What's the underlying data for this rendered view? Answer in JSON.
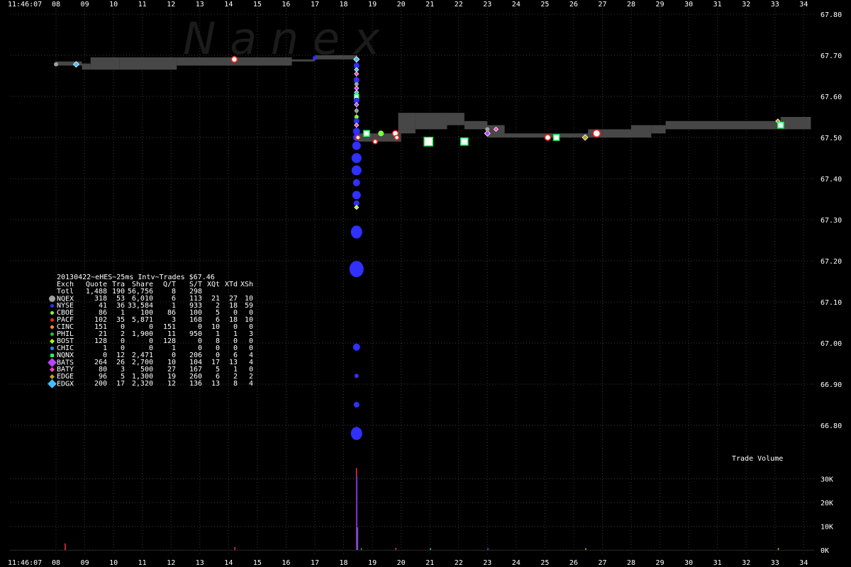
{
  "chart_data": {
    "type": "scatter",
    "watermark": "N a n e x",
    "title": "20130422~eHES~25ms Intv~Trades $67.46",
    "time_start_label": "11:46:07",
    "x_ticks": [
      "08",
      "09",
      "10",
      "11",
      "12",
      "13",
      "14",
      "15",
      "16",
      "17",
      "18",
      "19",
      "20",
      "21",
      "22",
      "23",
      "24",
      "25",
      "26",
      "27",
      "28",
      "29",
      "30",
      "31",
      "32",
      "33",
      "34"
    ],
    "price_ticks": [
      "67.80",
      "67.70",
      "67.60",
      "67.50",
      "67.40",
      "67.30",
      "67.20",
      "67.10",
      "67.00",
      "66.90",
      "66.80"
    ],
    "price_range": [
      66.75,
      67.8
    ],
    "volume_label": "Trade Volume",
    "volume_ticks": [
      "30K",
      "20K",
      "10K",
      "0K"
    ],
    "volume_range": [
      0,
      36000
    ],
    "grid": true,
    "legend_position": "left",
    "table": {
      "headers": [
        "Exch",
        "Quote",
        "Tra",
        "Share",
        "Q/T",
        "S/T",
        "XQt",
        "XTd",
        "XSh"
      ],
      "rows": [
        {
          "cells": [
            "Totl",
            "1,488",
            "190",
            "56,756",
            "8",
            "298",
            "",
            "",
            ""
          ],
          "marker": "",
          "color": ""
        },
        {
          "cells": [
            "NQEX",
            "318",
            "53",
            "6,010",
            "6",
            "113",
            "21",
            "27",
            "10"
          ],
          "marker": "circle-large",
          "color": "#a0a0a0"
        },
        {
          "cells": [
            "NYSE",
            "41",
            "36",
            "33,584",
            "1",
            "933",
            "2",
            "18",
            "59"
          ],
          "marker": "circle",
          "color": "#3030ff"
        },
        {
          "cells": [
            "CBOE",
            "86",
            "1",
            "100",
            "86",
            "100",
            "5",
            "0",
            "0"
          ],
          "marker": "circle",
          "color": "#80ff40"
        },
        {
          "cells": [
            "PACF",
            "102",
            "35",
            "5,871",
            "3",
            "168",
            "6",
            "18",
            "10"
          ],
          "marker": "circle",
          "color": "#ff2020"
        },
        {
          "cells": [
            "CINC",
            "151",
            "0",
            "0",
            "151",
            "0",
            "10",
            "0",
            "0"
          ],
          "marker": "circle",
          "color": "#ff9020"
        },
        {
          "cells": [
            "PHIL",
            "21",
            "2",
            "1,900",
            "11",
            "950",
            "1",
            "1",
            "3"
          ],
          "marker": "circle",
          "color": "#20c020"
        },
        {
          "cells": [
            "BOST",
            "128",
            "0",
            "0",
            "128",
            "0",
            "8",
            "0",
            "0"
          ],
          "marker": "diamond",
          "color": "#a0ff20"
        },
        {
          "cells": [
            "CHIC",
            "1",
            "0",
            "0",
            "1",
            "0",
            "0",
            "0",
            "0"
          ],
          "marker": "circle",
          "color": "#2090ff"
        },
        {
          "cells": [
            "NQNX",
            "0",
            "12",
            "2,471",
            "0",
            "206",
            "0",
            "6",
            "4"
          ],
          "marker": "square",
          "color": "#20ff60"
        },
        {
          "cells": [
            "BATS",
            "264",
            "26",
            "2,700",
            "10",
            "104",
            "17",
            "13",
            "4"
          ],
          "marker": "diamond-large",
          "color": "#c040ff"
        },
        {
          "cells": [
            "BATY",
            "80",
            "3",
            "500",
            "27",
            "167",
            "5",
            "1",
            "0"
          ],
          "marker": "diamond",
          "color": "#ff40c0"
        },
        {
          "cells": [
            "EDGE",
            "96",
            "5",
            "1,300",
            "19",
            "260",
            "6",
            "2",
            "2"
          ],
          "marker": "diamond",
          "color": "#c0a020"
        },
        {
          "cells": [
            "EDGX",
            "200",
            "17",
            "2,320",
            "12",
            "136",
            "13",
            "8",
            "4"
          ],
          "marker": "diamond-large",
          "color": "#40c0ff"
        }
      ]
    },
    "nbbo_band": [
      {
        "x": [
          7.98,
          8.9
        ],
        "low": 67.675,
        "high": 67.685
      },
      {
        "x": [
          8.9,
          9.2
        ],
        "low": 67.665,
        "high": 67.68
      },
      {
        "x": [
          9.2,
          10.2
        ],
        "low": 67.665,
        "high": 67.695
      },
      {
        "x": [
          10.2,
          12.2
        ],
        "low": 67.665,
        "high": 67.695
      },
      {
        "x": [
          12.2,
          16.2
        ],
        "low": 67.675,
        "high": 67.695
      },
      {
        "x": [
          16.2,
          17.0
        ],
        "low": 67.685,
        "high": 67.69
      },
      {
        "x": [
          17.0,
          18.45
        ],
        "low": 67.69,
        "high": 67.7
      },
      {
        "x": [
          18.5,
          19.0
        ],
        "low": 67.49,
        "high": 67.51
      },
      {
        "x": [
          19.0,
          20.0
        ],
        "low": 67.49,
        "high": 67.51
      },
      {
        "x": [
          19.9,
          20.5
        ],
        "low": 67.51,
        "high": 67.56
      },
      {
        "x": [
          20.5,
          21.6
        ],
        "low": 67.52,
        "high": 67.56
      },
      {
        "x": [
          21.6,
          22.2
        ],
        "low": 67.53,
        "high": 67.56
      },
      {
        "x": [
          22.2,
          23.0
        ],
        "low": 67.52,
        "high": 67.54
      },
      {
        "x": [
          23.0,
          23.6
        ],
        "low": 67.5,
        "high": 67.53
      },
      {
        "x": [
          23.6,
          24.4
        ],
        "low": 67.5,
        "high": 67.51
      },
      {
        "x": [
          24.4,
          26.5
        ],
        "low": 67.5,
        "high": 67.51
      },
      {
        "x": [
          26.5,
          27.0
        ],
        "low": 67.5,
        "high": 67.52
      },
      {
        "x": [
          27.0,
          28.0
        ],
        "low": 67.5,
        "high": 67.52
      },
      {
        "x": [
          28.0,
          28.7
        ],
        "low": 67.5,
        "high": 67.53
      },
      {
        "x": [
          28.7,
          29.2
        ],
        "low": 67.51,
        "high": 67.53
      },
      {
        "x": [
          29.2,
          33.2
        ],
        "low": 67.52,
        "high": 67.54
      },
      {
        "x": [
          33.2,
          34.25
        ],
        "low": 67.52,
        "high": 67.55
      }
    ],
    "trades": [
      {
        "x": 8.0,
        "y": 67.678,
        "exch": "NQEX",
        "r": 3
      },
      {
        "x": 8.7,
        "y": 67.678,
        "exch": "EDGX",
        "r": 4
      },
      {
        "x": 14.2,
        "y": 67.69,
        "exch": "PACF",
        "r": 4
      },
      {
        "x": 17.0,
        "y": 67.693,
        "exch": "NYSE",
        "r": 3
      },
      {
        "x": 18.45,
        "y": 67.69,
        "exch": "EDGX",
        "r": 4
      },
      {
        "x": 18.45,
        "y": 67.675,
        "exch": "NYSE",
        "r": 4
      },
      {
        "x": 18.45,
        "y": 67.665,
        "exch": "EDGX",
        "r": 3
      },
      {
        "x": 18.45,
        "y": 67.655,
        "exch": "BATY",
        "r": 3
      },
      {
        "x": 18.45,
        "y": 67.64,
        "exch": "NYSE",
        "r": 4
      },
      {
        "x": 18.45,
        "y": 67.63,
        "exch": "NQEX",
        "r": 3
      },
      {
        "x": 18.45,
        "y": 67.62,
        "exch": "BATS",
        "r": 3
      },
      {
        "x": 18.45,
        "y": 67.61,
        "exch": "EDGX",
        "r": 3
      },
      {
        "x": 18.45,
        "y": 67.6,
        "exch": "NQNX",
        "r": 3
      },
      {
        "x": 18.45,
        "y": 67.59,
        "exch": "NYSE",
        "r": 4
      },
      {
        "x": 18.45,
        "y": 67.58,
        "exch": "BATS",
        "r": 3
      },
      {
        "x": 18.45,
        "y": 67.565,
        "exch": "NQEX",
        "r": 3
      },
      {
        "x": 18.45,
        "y": 67.55,
        "exch": "CBOE",
        "r": 3
      },
      {
        "x": 18.45,
        "y": 67.54,
        "exch": "NYSE",
        "r": 4
      },
      {
        "x": 18.45,
        "y": 67.53,
        "exch": "BATY",
        "r": 3
      },
      {
        "x": 18.45,
        "y": 67.515,
        "exch": "NYSE",
        "r": 5
      },
      {
        "x": 18.45,
        "y": 67.5,
        "exch": "NYSE",
        "r": 5
      },
      {
        "x": 18.45,
        "y": 67.48,
        "exch": "NYSE",
        "r": 6
      },
      {
        "x": 18.45,
        "y": 67.45,
        "exch": "NYSE",
        "r": 7
      },
      {
        "x": 18.45,
        "y": 67.42,
        "exch": "NYSE",
        "r": 7
      },
      {
        "x": 18.45,
        "y": 67.39,
        "exch": "NYSE",
        "r": 5
      },
      {
        "x": 18.45,
        "y": 67.36,
        "exch": "NYSE",
        "r": 6
      },
      {
        "x": 18.45,
        "y": 67.34,
        "exch": "NYSE",
        "r": 4
      },
      {
        "x": 18.45,
        "y": 67.33,
        "exch": "BOST",
        "r": 3
      },
      {
        "x": 18.45,
        "y": 67.27,
        "exch": "NYSE",
        "r": 8
      },
      {
        "x": 18.45,
        "y": 67.18,
        "exch": "NYSE",
        "r": 10
      },
      {
        "x": 18.45,
        "y": 66.99,
        "exch": "NYSE",
        "r": 5
      },
      {
        "x": 18.45,
        "y": 66.92,
        "exch": "NYSE",
        "r": 3
      },
      {
        "x": 18.45,
        "y": 66.85,
        "exch": "NYSE",
        "r": 4
      },
      {
        "x": 18.45,
        "y": 66.78,
        "exch": "NYSE",
        "r": 8
      },
      {
        "x": 18.5,
        "y": 67.5,
        "exch": "PACF",
        "r": 3
      },
      {
        "x": 18.8,
        "y": 67.51,
        "exch": "NQNX",
        "r": 4
      },
      {
        "x": 19.1,
        "y": 67.49,
        "exch": "PACF",
        "r": 3
      },
      {
        "x": 19.3,
        "y": 67.51,
        "exch": "CBOE",
        "r": 4
      },
      {
        "x": 19.8,
        "y": 67.51,
        "exch": "PACF",
        "r": 4
      },
      {
        "x": 19.85,
        "y": 67.5,
        "exch": "PACF",
        "r": 3
      },
      {
        "x": 20.95,
        "y": 67.49,
        "exch": "NQNX",
        "r": 6
      },
      {
        "x": 22.2,
        "y": 67.49,
        "exch": "NQNX",
        "r": 5
      },
      {
        "x": 23.0,
        "y": 67.51,
        "exch": "BATS",
        "r": 4
      },
      {
        "x": 23.0,
        "y": 67.52,
        "exch": "NQEX",
        "r": 3
      },
      {
        "x": 23.3,
        "y": 67.52,
        "exch": "BATY",
        "r": 3
      },
      {
        "x": 25.1,
        "y": 67.5,
        "exch": "PACF",
        "r": 4
      },
      {
        "x": 25.4,
        "y": 67.5,
        "exch": "NQNX",
        "r": 4
      },
      {
        "x": 26.4,
        "y": 67.5,
        "exch": "EDGE",
        "r": 4
      },
      {
        "x": 26.8,
        "y": 67.51,
        "exch": "PACF",
        "r": 5
      },
      {
        "x": 33.1,
        "y": 67.54,
        "exch": "EDGE",
        "r": 3
      },
      {
        "x": 33.2,
        "y": 67.53,
        "exch": "NQNX",
        "r": 4
      }
    ],
    "volume_bars": [
      {
        "x": 8.3,
        "value": 2800,
        "color": "#ff3030"
      },
      {
        "x": 14.2,
        "value": 1200,
        "color": "#ff3030"
      },
      {
        "x": 18.43,
        "value": 34500,
        "color": "#ff3030"
      },
      {
        "x": 18.45,
        "value": 31000,
        "color": "#3030ff"
      },
      {
        "x": 18.47,
        "value": 9500,
        "color": "#6060ff"
      },
      {
        "x": 18.6,
        "value": 800,
        "color": "#20c020"
      },
      {
        "x": 19.8,
        "value": 900,
        "color": "#ff3030"
      },
      {
        "x": 21.0,
        "value": 700,
        "color": "#20ff60"
      },
      {
        "x": 23.0,
        "value": 700,
        "color": "#c040ff"
      },
      {
        "x": 26.4,
        "value": 800,
        "color": "#c0a020"
      },
      {
        "x": 33.1,
        "value": 900,
        "color": "#c0a020"
      }
    ]
  }
}
